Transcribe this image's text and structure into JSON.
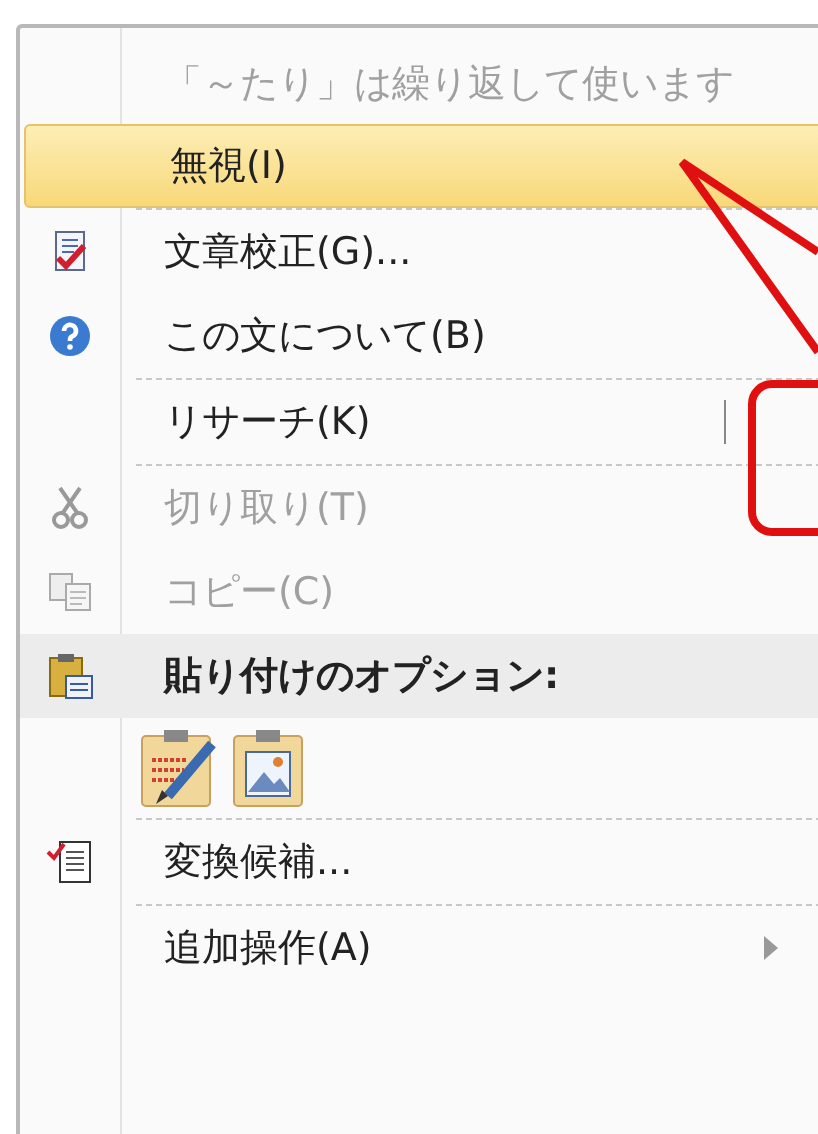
{
  "menu": {
    "items": [
      {
        "kind": "caption",
        "label": "「～たり」は繰り返して使います",
        "disabled": true
      },
      {
        "kind": "item",
        "label": "無視(I)",
        "disabled": false,
        "selected": true,
        "divider_after": true
      },
      {
        "kind": "item",
        "label": "文章校正(G)...",
        "disabled": false,
        "selected": false
      },
      {
        "kind": "item",
        "label": "この文について(B)",
        "disabled": false,
        "selected": false,
        "divider_after": true
      },
      {
        "kind": "item",
        "label": "リサーチ(K)",
        "disabled": false,
        "selected": false,
        "divider_after": true
      },
      {
        "kind": "item",
        "label": "切り取り(T)",
        "disabled": true,
        "selected": false
      },
      {
        "kind": "item",
        "label": "コピー(C)",
        "disabled": true,
        "selected": false
      },
      {
        "kind": "header",
        "label": "貼り付けのオプション:"
      },
      {
        "kind": "paste_options",
        "divider_after": true
      },
      {
        "kind": "item",
        "label": "変換候補...",
        "disabled": false,
        "selected": false,
        "divider_after": true
      },
      {
        "kind": "item",
        "label": "追加操作(A)",
        "disabled": false,
        "selected": false,
        "has_submenu": true
      }
    ]
  }
}
